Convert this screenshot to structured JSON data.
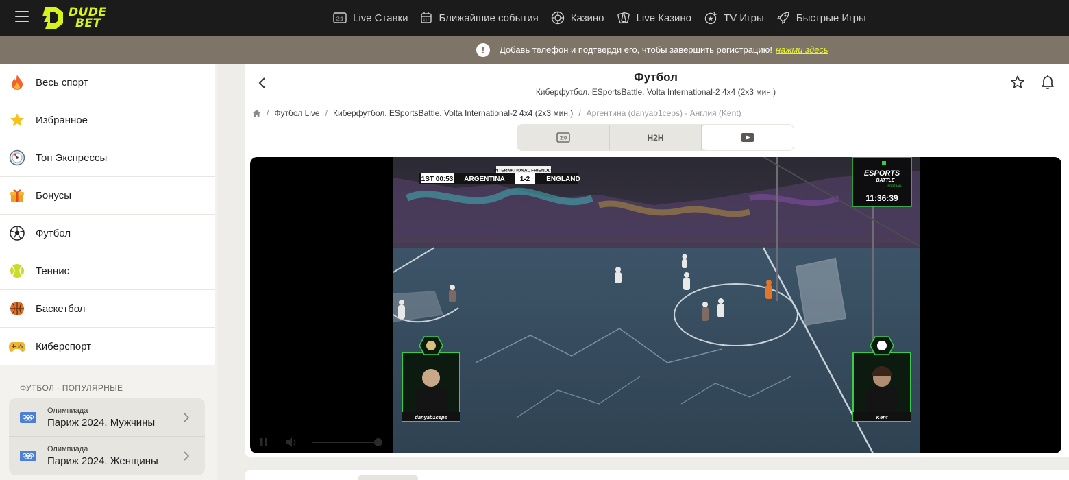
{
  "brand": {
    "line1": "DUDE",
    "line2": "BET",
    "accent": "#d7f31a"
  },
  "nav": [
    {
      "label": "Live Ставки",
      "icon": "live-bets-icon"
    },
    {
      "label": "Ближайшие события",
      "icon": "calendar-icon"
    },
    {
      "label": "Казино",
      "icon": "casino-chip-icon"
    },
    {
      "label": "Live Казино",
      "icon": "cards-icon"
    },
    {
      "label": "TV Игры",
      "icon": "tv-games-icon"
    },
    {
      "label": "Быстрые Игры",
      "icon": "rocket-icon"
    }
  ],
  "notice": {
    "text": "Добавь телефон и подтверди его, чтобы завершить регистрацию!",
    "link": "нажми здесь"
  },
  "sidebar": {
    "items": [
      {
        "label": "Весь спорт",
        "icon": "fire-icon"
      },
      {
        "label": "Избранное",
        "icon": "star-icon"
      },
      {
        "label": "Топ Экспрессы",
        "icon": "gauge-icon"
      },
      {
        "label": "Бонусы",
        "icon": "gift-icon"
      },
      {
        "label": "Футбол",
        "icon": "soccer-ball-icon"
      },
      {
        "label": "Теннис",
        "icon": "tennis-ball-icon"
      },
      {
        "label": "Баскетбол",
        "icon": "basketball-icon"
      },
      {
        "label": "Киберспорт",
        "icon": "gamepad-icon"
      }
    ],
    "popular_title": "ФУТБОЛ · ПОПУЛЯРНЫЕ",
    "popular": [
      {
        "category": "Олимпиада",
        "name": "Париж 2024. Мужчины"
      },
      {
        "category": "Олимпиада",
        "name": "Париж 2024. Женщины"
      }
    ]
  },
  "event": {
    "title": "Футбол",
    "subtitle": "Киберфутбол. ESportsBattle. Volta International-2 4x4 (2x3 мин.)"
  },
  "breadcrumbs": [
    "Футбол Live",
    "Киберфутбол. ESportsBattle. Volta International-2 4x4 (2x3 мин.)",
    "Аргентина (danyab1ceps) - Англия (Kent)"
  ],
  "tabs": [
    {
      "label": "2:0",
      "icon": "scoreboard-icon",
      "active": false
    },
    {
      "label": "H2H",
      "icon": "",
      "active": false
    },
    {
      "label": "",
      "icon": "play-video-icon",
      "active": true
    }
  ],
  "stream": {
    "match_type": "INTERNATIONAL FRIENDLY",
    "clock": "1ST 00:53",
    "home": "ARGENTINA",
    "away": "ENGLAND",
    "score": "1-2",
    "broadcaster_line1": "ESPORTS",
    "broadcaster_line2": "BATTLE",
    "broadcaster_line3": "FOOTBALL",
    "time": "11:36:39",
    "player_left": "danyab1ceps",
    "player_right": "Kent"
  }
}
